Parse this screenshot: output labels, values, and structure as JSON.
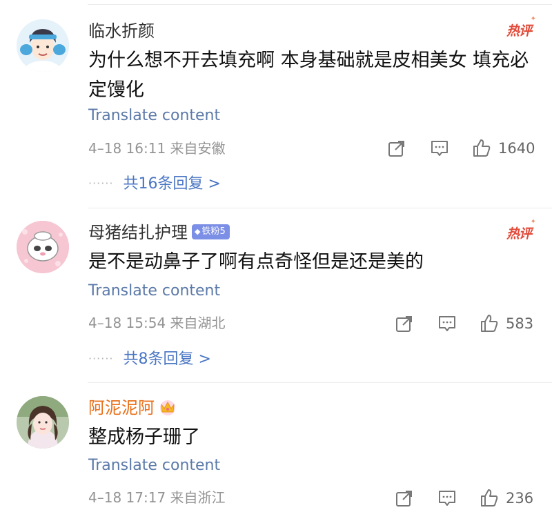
{
  "comments": [
    {
      "username": "临水折颜",
      "hot_label": "热评",
      "text": "为什么想不开去填充啊 本身基础就是皮相美女 填充必定馒化",
      "translate": "Translate content",
      "meta": "4–18 16:11 来自安徽",
      "likes": "1640",
      "replies": "共16条回复 >",
      "reply_dots": "······"
    },
    {
      "username": "母猪结扎护理",
      "badge": "铁粉5",
      "hot_label": "热评",
      "text": "是不是动鼻子了啊有点奇怪但是还是美的",
      "translate": "Translate content",
      "meta": "4–18 15:54 来自湖北",
      "likes": "583",
      "replies": "共8条回复 >",
      "reply_dots": "······"
    },
    {
      "username": "阿泥泥阿",
      "text": "整成杨子珊了",
      "translate": "Translate content",
      "meta": "4–18 17:17 来自浙江",
      "likes": "236"
    }
  ],
  "icons": {
    "share": "share-icon",
    "comment": "comment-icon",
    "like": "thumbs-up-icon",
    "crown": "crown-icon",
    "diamond": "diamond-icon"
  },
  "colors": {
    "link_blue": "#5b79a8",
    "reply_blue": "#4a76c4",
    "hot_red": "#e14b3a",
    "vip_orange": "#e8701a",
    "fan_badge": "#7c8fe6"
  }
}
